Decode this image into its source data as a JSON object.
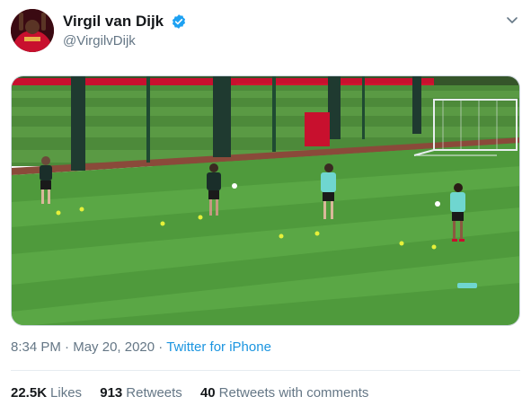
{
  "user": {
    "display_name": "Virgil van Dijk",
    "handle": "@VirgilvDijk",
    "verified": true,
    "verified_color": "#1da1f2"
  },
  "icons": {
    "menu": "chevron-down-icon",
    "verified": "verified-badge-icon"
  },
  "media": {
    "subject": "Players training on a football pitch in green training kit with cones, a goal and windbreak screens"
  },
  "meta": {
    "time": "8:34 PM",
    "separator1": "·",
    "date": "May 20, 2020",
    "separator2": "·",
    "source": "Twitter for iPhone",
    "source_color": "#1b95e0"
  },
  "stats": {
    "likes_count": "22.5K",
    "likes_label": "Likes",
    "retweets_count": "913",
    "retweets_label": "Retweets",
    "comments_count": "40",
    "comments_label": "Retweets with comments"
  }
}
